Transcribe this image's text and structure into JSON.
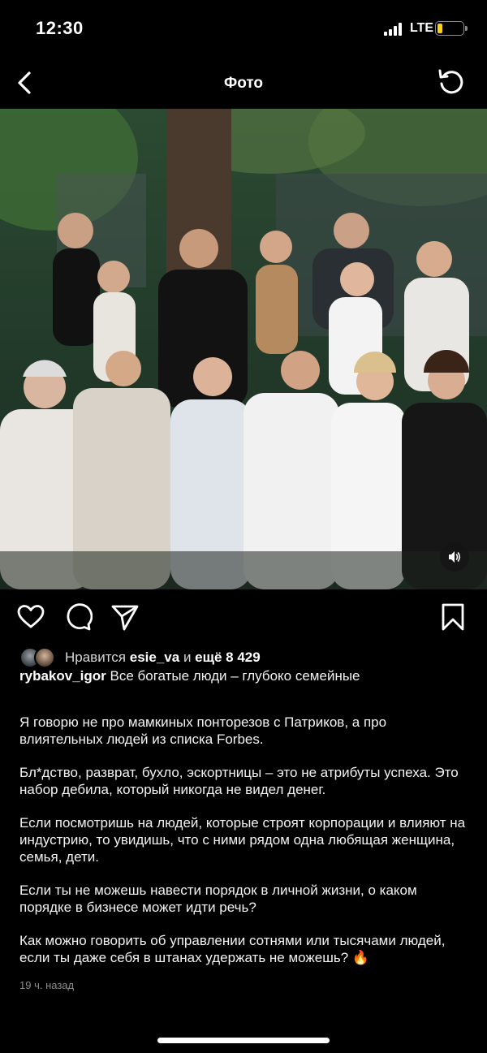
{
  "status_bar": {
    "time": "12:30",
    "network": "LTE",
    "battery_level": 0.2,
    "battery_color": "#f7d11a"
  },
  "header": {
    "title": "Фото"
  },
  "photo": {
    "description_icon": "family-group-photo"
  },
  "likes": {
    "prefix": "Нравится",
    "user": "esie_va",
    "conjunction": "и",
    "more": "ещё 8 429"
  },
  "caption": {
    "username": "rybakov_igor",
    "first_line": "Все богатые люди – глубоко семейные",
    "paragraphs": [
      "Я говорю не про мамкиных понторезов с Патриков, а про влиятельных людей из списка Forbes.",
      "Бл*дство, разврат, бухло, эскортницы – это не атрибуты успеха. Это набор дебила, который никогда не видел денег.",
      "Если посмотришь на людей, которые строят корпорации и влияют на индустрию, то увидишь, что с ними рядом одна любящая женщина, семья, дети.",
      "Если ты не можешь навести порядок в личной жизни, о каком порядке в бизнесе может идти речь?",
      "Как можно говорить об управлении сотнями или тысячами людей, если ты даже себя в штанах удержать не можешь?"
    ],
    "emoji": "🔥"
  },
  "timestamp": "19 ч. назад",
  "icons": {
    "back": "chevron-left-icon",
    "refresh": "refresh-icon",
    "like": "heart-icon",
    "comment": "comment-icon",
    "share": "send-icon",
    "save": "bookmark-icon",
    "sound": "speaker-icon"
  }
}
